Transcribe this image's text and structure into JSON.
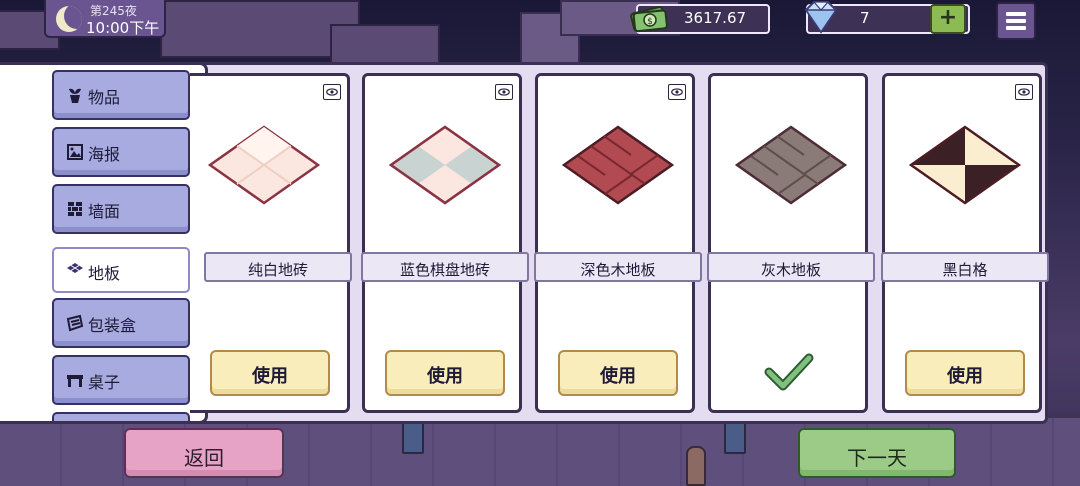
{
  "hud": {
    "day": "第245夜",
    "time": "10:00下午",
    "money": "3617.67",
    "gems": "7",
    "add_gem_label": "+"
  },
  "sidenav": {
    "items": [
      {
        "label": "物品",
        "icon": "plant-pot-icon"
      },
      {
        "label": "海报",
        "icon": "poster-icon"
      },
      {
        "label": "墙面",
        "icon": "wall-icon"
      },
      {
        "label": "地板",
        "icon": "floor-tiles-icon",
        "active": true
      },
      {
        "label": "包装盒",
        "icon": "package-box-icon"
      },
      {
        "label": "桌子",
        "icon": "table-icon"
      }
    ]
  },
  "cards": [
    {
      "name": "纯白地砖",
      "action": "使用",
      "pattern": "white-tiles",
      "colors": [
        "#fbe7df",
        "#f4d6cb",
        "#8b3343"
      ]
    },
    {
      "name": "蓝色棋盘地砖",
      "action": "使用",
      "pattern": "blue-checker",
      "colors": [
        "#c9d3d2",
        "#fbe7df",
        "#8b3343"
      ]
    },
    {
      "name": "深色木地板",
      "action": "使用",
      "pattern": "dark-wood",
      "colors": [
        "#b24a52",
        "#7a2730",
        "#4d1c24"
      ]
    },
    {
      "name": "灰木地板",
      "action": "selected",
      "pattern": "grey-wood",
      "colors": [
        "#8b7b78",
        "#6b5a59",
        "#4d2c36"
      ]
    },
    {
      "name": "黑白格",
      "action": "使用",
      "pattern": "black-white",
      "colors": [
        "#3b2025",
        "#fbedd0",
        "#4d1c24"
      ]
    }
  ],
  "buttons": {
    "back": "返回",
    "next_day": "下一天"
  },
  "colors": {
    "panel_bg": "#e4ddf1",
    "nav_button": "#a8abe0",
    "use_button": "#f8edbb",
    "back_button": "#e6a3c6",
    "next_button": "#9bcb86",
    "check_mark": "#5aa85c"
  }
}
